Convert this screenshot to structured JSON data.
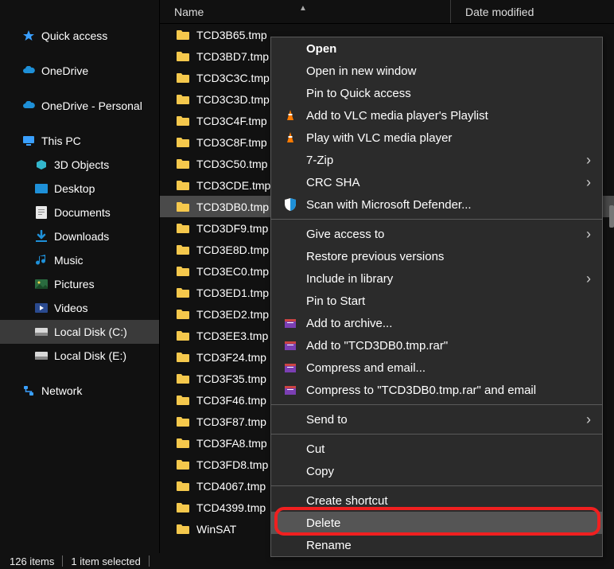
{
  "header": {
    "col_name": "Name",
    "col_date": "Date modified"
  },
  "nav": {
    "quick_access": "Quick access",
    "onedrive": "OneDrive",
    "onedrive_personal": "OneDrive - Personal",
    "this_pc": "This PC",
    "objects3d": "3D Objects",
    "desktop": "Desktop",
    "documents": "Documents",
    "downloads": "Downloads",
    "music": "Music",
    "pictures": "Pictures",
    "videos": "Videos",
    "local_c": "Local Disk (C:)",
    "local_e": "Local Disk (E:)",
    "network": "Network"
  },
  "files": [
    {
      "name": "TCD3B65.tmp"
    },
    {
      "name": "TCD3BD7.tmp"
    },
    {
      "name": "TCD3C3C.tmp"
    },
    {
      "name": "TCD3C3D.tmp"
    },
    {
      "name": "TCD3C4F.tmp"
    },
    {
      "name": "TCD3C8F.tmp"
    },
    {
      "name": "TCD3C50.tmp"
    },
    {
      "name": "TCD3CDE.tmp"
    },
    {
      "name": "TCD3DB0.tmp",
      "selected": true
    },
    {
      "name": "TCD3DF9.tmp"
    },
    {
      "name": "TCD3E8D.tmp"
    },
    {
      "name": "TCD3EC0.tmp"
    },
    {
      "name": "TCD3ED1.tmp"
    },
    {
      "name": "TCD3ED2.tmp"
    },
    {
      "name": "TCD3EE3.tmp"
    },
    {
      "name": "TCD3F24.tmp"
    },
    {
      "name": "TCD3F35.tmp"
    },
    {
      "name": "TCD3F46.tmp"
    },
    {
      "name": "TCD3F87.tmp"
    },
    {
      "name": "TCD3FA8.tmp"
    },
    {
      "name": "TCD3FD8.tmp"
    },
    {
      "name": "TCD4067.tmp"
    },
    {
      "name": "TCD4399.tmp"
    },
    {
      "name": "WinSAT"
    }
  ],
  "ctx": {
    "open": "Open",
    "open_new_window": "Open in new window",
    "pin_quick_access": "Pin to Quick access",
    "vlc_playlist": "Add to VLC media player's Playlist",
    "vlc_play": "Play with VLC media player",
    "seven_zip": "7-Zip",
    "crc_sha": "CRC SHA",
    "defender": "Scan with Microsoft Defender...",
    "give_access": "Give access to",
    "restore_prev": "Restore previous versions",
    "include_lib": "Include in library",
    "pin_start": "Pin to Start",
    "add_archive": "Add to archive...",
    "add_named": "Add to \"TCD3DB0.tmp.rar\"",
    "compress_email": "Compress and email...",
    "compress_named_email": "Compress to \"TCD3DB0.tmp.rar\" and email",
    "send_to": "Send to",
    "cut": "Cut",
    "copy": "Copy",
    "create_shortcut": "Create shortcut",
    "delete": "Delete",
    "rename": "Rename"
  },
  "status": {
    "items": "126 items",
    "selected": "1 item selected"
  }
}
